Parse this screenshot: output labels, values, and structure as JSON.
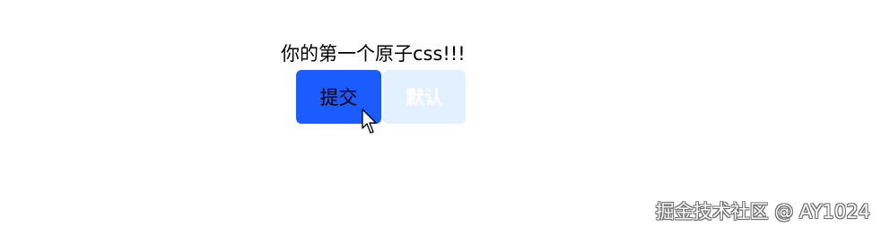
{
  "heading": "你的第一个原子css!!!",
  "buttons": {
    "submit_label": "提交",
    "default_label": "默认"
  },
  "watermark": "掘金技术社区 @ AY1024",
  "colors": {
    "submit_bg": "#1a5cff",
    "default_bg": "#e3f0ff",
    "background": "#ffffff"
  },
  "icons": {
    "cursor": "mouse-pointer-icon"
  }
}
